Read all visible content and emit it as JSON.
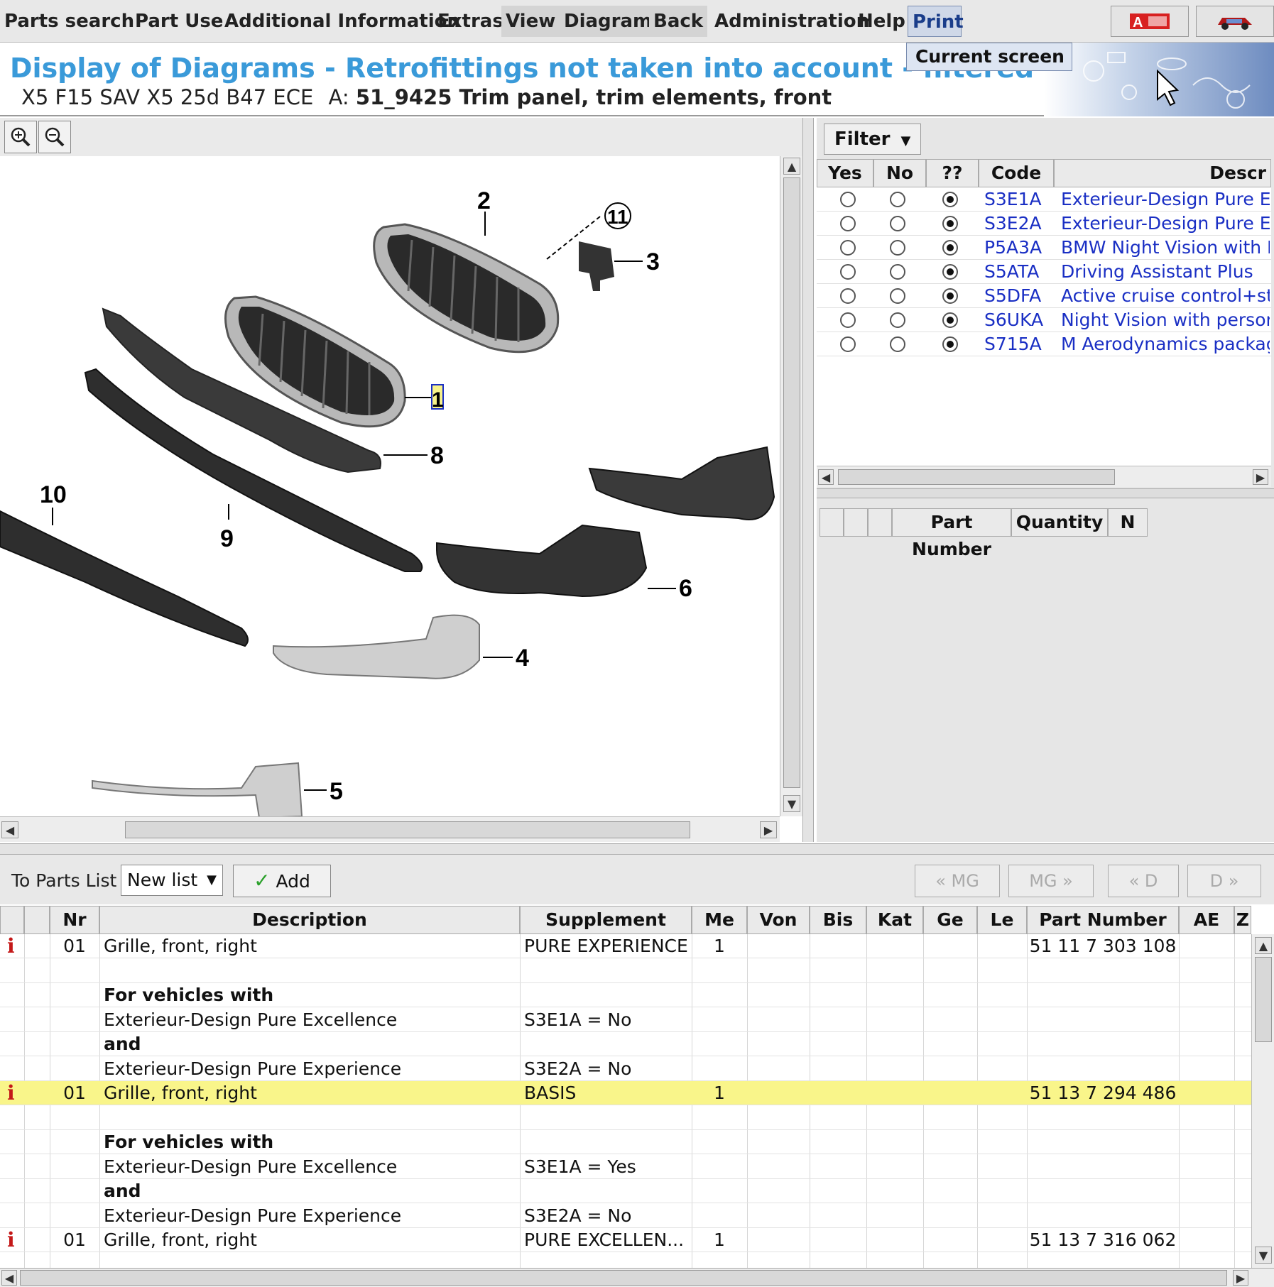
{
  "menu": {
    "items": [
      "Parts search",
      "Part Use",
      "Additional Information",
      "Extras",
      "View",
      "Diagram",
      "Back",
      "Administration",
      "Help",
      "Print"
    ],
    "print_dropdown": "Current screen"
  },
  "title": {
    "heading": "Display of Diagrams - Retrofittings not taken into account - filtered",
    "vehicle": "X5 F15 SAV X5 25d B47 ECE",
    "a_prefix": "A:",
    "group": "51_9425 Trim panel, trim elements, front"
  },
  "diagram": {
    "callouts": [
      "2",
      "11",
      "3",
      "1",
      "8",
      "10",
      "9",
      "6",
      "4",
      "5"
    ]
  },
  "filter": {
    "button": "Filter",
    "headers": [
      "Yes",
      "No",
      "??",
      "Code",
      "Descr"
    ],
    "rows": [
      {
        "code": "S3E1A",
        "desc": "Exterieur-Design Pure Exc"
      },
      {
        "code": "S3E2A",
        "desc": "Exterieur-Design Pure Exp"
      },
      {
        "code": "P5A3A",
        "desc": "BMW Night Vision with Dyi"
      },
      {
        "code": "S5ATA",
        "desc": "Driving Assistant Plus"
      },
      {
        "code": "S5DFA",
        "desc": "Active cruise control+stop"
      },
      {
        "code": "S6UKA",
        "desc": "Night Vision with person re"
      },
      {
        "code": "S715A",
        "desc": "M Aerodynamics package"
      }
    ],
    "selected_option": "??",
    "parts_headers": [
      "Part Number",
      "Quantity",
      "N"
    ]
  },
  "parts_list_toolbar": {
    "label": "To Parts List",
    "list_select": "New list",
    "add": "Add",
    "nav": [
      "« MG",
      "MG »",
      "« D",
      "D »"
    ]
  },
  "parts_table": {
    "headers": [
      "Nr",
      "Description",
      "Supplement",
      "Me",
      "Von",
      "Bis",
      "Kat",
      "Ge",
      "Le",
      "Part Number",
      "AE",
      "Z"
    ],
    "rows": [
      {
        "info": "i",
        "nr": "01",
        "desc": "Grille, front, right",
        "supp": "PURE EXPERIENCE",
        "me": "1",
        "pn": "51 11 7 303 108",
        "bold": false,
        "hl": false
      },
      {
        "info": "",
        "nr": "",
        "desc": "",
        "supp": "",
        "me": "",
        "pn": "",
        "bold": false,
        "hl": false
      },
      {
        "info": "",
        "nr": "",
        "desc": "For vehicles with",
        "supp": "",
        "me": "",
        "pn": "",
        "bold": true,
        "hl": false
      },
      {
        "info": "",
        "nr": "",
        "desc": "Exterieur-Design Pure Excellence",
        "supp": "S3E1A = No",
        "me": "",
        "pn": "",
        "bold": false,
        "hl": false
      },
      {
        "info": "",
        "nr": "",
        "desc": "and",
        "supp": "",
        "me": "",
        "pn": "",
        "bold": true,
        "hl": false
      },
      {
        "info": "",
        "nr": "",
        "desc": "Exterieur-Design Pure Experience",
        "supp": "S3E2A = No",
        "me": "",
        "pn": "",
        "bold": false,
        "hl": false
      },
      {
        "info": "i",
        "nr": "01",
        "desc": "Grille, front, right",
        "supp": "BASIS",
        "me": "1",
        "pn": "51 13 7 294 486",
        "bold": false,
        "hl": true
      },
      {
        "info": "",
        "nr": "",
        "desc": "",
        "supp": "",
        "me": "",
        "pn": "",
        "bold": false,
        "hl": false
      },
      {
        "info": "",
        "nr": "",
        "desc": "For vehicles with",
        "supp": "",
        "me": "",
        "pn": "",
        "bold": true,
        "hl": false
      },
      {
        "info": "",
        "nr": "",
        "desc": "Exterieur-Design Pure Excellence",
        "supp": "S3E1A = Yes",
        "me": "",
        "pn": "",
        "bold": false,
        "hl": false
      },
      {
        "info": "",
        "nr": "",
        "desc": "and",
        "supp": "",
        "me": "",
        "pn": "",
        "bold": true,
        "hl": false
      },
      {
        "info": "",
        "nr": "",
        "desc": "Exterieur-Design Pure Experience",
        "supp": "S3E2A = No",
        "me": "",
        "pn": "",
        "bold": false,
        "hl": false
      },
      {
        "info": "i",
        "nr": "01",
        "desc": "Grille, front, right",
        "supp": "PURE EXCELLEN...",
        "me": "1",
        "pn": "51 13 7 316 062",
        "bold": false,
        "hl": false
      }
    ]
  },
  "colors": {
    "title_blue": "#3a9ad9",
    "link_blue": "#1a2fc4",
    "highlight_yellow": "#f9f58a",
    "info_red": "#c41818"
  }
}
